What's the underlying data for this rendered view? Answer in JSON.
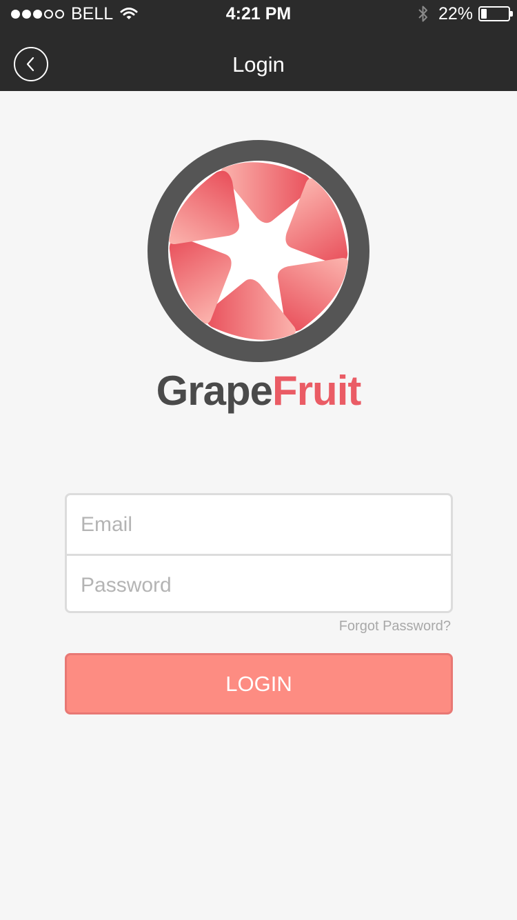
{
  "status_bar": {
    "carrier": "BELL",
    "time": "4:21 PM",
    "battery_percent": "22%",
    "battery_level": 0.22,
    "signal_strength": 3,
    "signal_max": 5
  },
  "nav": {
    "title": "Login",
    "back_icon": "chevron-left-icon"
  },
  "brand": {
    "name_part_1": "Grape",
    "name_part_2": "Fruit",
    "logo_icon": "camera-aperture-icon"
  },
  "form": {
    "email_placeholder": "Email",
    "email_value": "",
    "password_placeholder": "Password",
    "password_value": "",
    "forgot_label": "Forgot Password?",
    "login_label": "LOGIN"
  },
  "colors": {
    "top_bar": "#2b2b2b",
    "background": "#f6f6f6",
    "brand_gray": "#4a4a4a",
    "brand_red": "#ea5c65",
    "login_button": "#fd8c82",
    "logo_ring": "#555555"
  }
}
